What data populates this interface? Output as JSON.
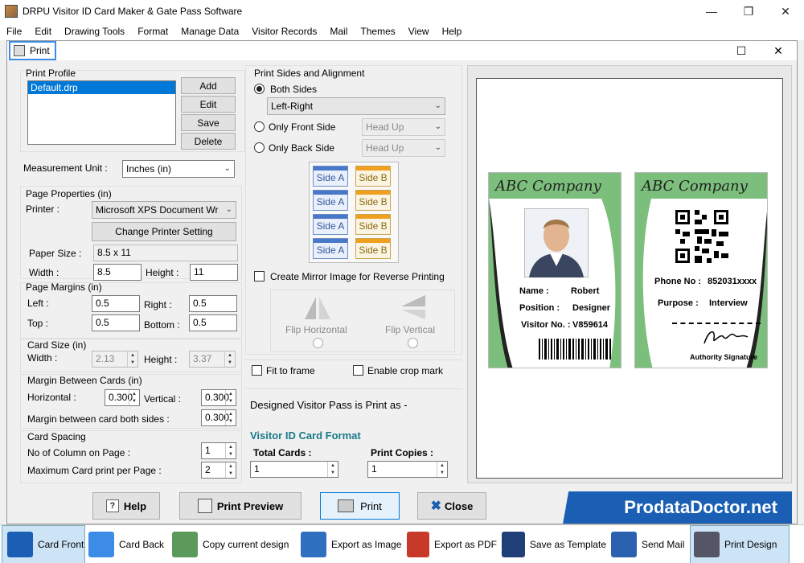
{
  "app": {
    "title": "DRPU Visitor ID Card Maker & Gate Pass Software"
  },
  "menu": [
    "File",
    "Edit",
    "Drawing Tools",
    "Format",
    "Manage Data",
    "Visitor Records",
    "Mail",
    "Themes",
    "View",
    "Help"
  ],
  "dialog": {
    "title": "Print",
    "print_profile": {
      "label": "Print Profile",
      "items": [
        "Default.drp"
      ],
      "buttons": {
        "add": "Add",
        "edit": "Edit",
        "save": "Save",
        "delete": "Delete"
      }
    },
    "measurement": {
      "label": "Measurement Unit :",
      "value": "Inches (in)"
    },
    "page_properties": {
      "label": "Page Properties (in)",
      "printer_label": "Printer :",
      "printer_value": "Microsoft XPS Document Wr",
      "change_printer": "Change Printer Setting",
      "paper_size_label": "Paper Size :",
      "paper_size_value": "8.5 x 11",
      "width_label": "Width :",
      "width_value": "8.5",
      "height_label": "Height :",
      "height_value": "11"
    },
    "page_margins": {
      "label": "Page Margins (in)",
      "left_label": "Left :",
      "left": "0.5",
      "right_label": "Right :",
      "right": "0.5",
      "top_label": "Top :",
      "top": "0.5",
      "bottom_label": "Bottom :",
      "bottom": "0.5"
    },
    "card_size": {
      "label": "Card Size (in)",
      "width_label": "Width :",
      "width": "2.13",
      "height_label": "Height :",
      "height": "3.37"
    },
    "margin_between": {
      "label": "Margin Between Cards (in)",
      "horizontal_label": "Horizontal :",
      "horizontal": "0.300",
      "vertical_label": "Vertical :",
      "vertical": "0.300",
      "both_label": "Margin between card both sides :",
      "both": "0.300"
    },
    "card_spacing": {
      "label": "Card Spacing",
      "columns_label": "No of Column on Page :",
      "columns": "1",
      "max_label": "Maximum Card print per Page :",
      "max": "2"
    },
    "sides": {
      "label": "Print Sides and Alignment",
      "both": "Both Sides",
      "both_value": "Left-Right",
      "front": "Only Front Side",
      "front_value": "Head Up",
      "back": "Only Back Side",
      "back_value": "Head Up",
      "grid": [
        [
          "Side A",
          "Side B"
        ],
        [
          "Side A",
          "Side B"
        ],
        [
          "Side A",
          "Side B"
        ],
        [
          "Side A",
          "Side B"
        ]
      ],
      "mirror": "Create Mirror Image for Reverse Printing",
      "flip_h": "Flip Horizontal",
      "flip_v": "Flip Vertical"
    },
    "fit": "Fit to frame",
    "crop": "Enable crop mark",
    "designed_as": "Designed Visitor Pass is Print as -",
    "format_title": "Visitor ID Card Format",
    "total_label": "Total Cards :",
    "total": "1",
    "copies_label": "Print Copies :",
    "copies": "1",
    "buttons": {
      "help": "Help",
      "preview": "Print Preview",
      "print": "Print",
      "close": "Close"
    },
    "brand": "ProdataDoctor.net"
  },
  "card_front": {
    "company": "ABC Company",
    "name_label": "Name :",
    "name": "Robert",
    "position_label": "Position :",
    "position": "Designer",
    "visitor_label": "Visitor No. :",
    "visitor": "V859614"
  },
  "card_back": {
    "company": "ABC Company",
    "phone_label": "Phone No :",
    "phone": "852031xxxx",
    "purpose_label": "Purpose :",
    "purpose": "Interview",
    "signature": "Authority Signature"
  },
  "toolbar": [
    "Card Front",
    "Card Back",
    "Copy current design",
    "Export as Image",
    "Export as PDF",
    "Save as Template",
    "Send Mail",
    "Print Design"
  ],
  "colors": {
    "accent": "#3c8ce7",
    "card_green": "#7cbf7c",
    "format_title": "#1a7a8a",
    "brand_bg": "#1a5fb4"
  }
}
